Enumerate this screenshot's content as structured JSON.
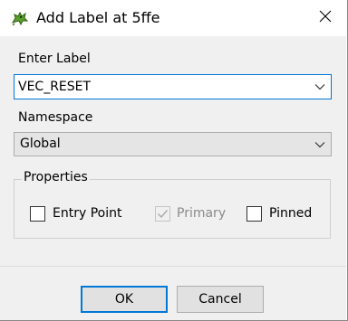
{
  "window": {
    "title": "Add Label at 5ffe",
    "icon": "green-dragon-icon",
    "close_icon": "close-icon"
  },
  "label_field": {
    "label": "Enter Label",
    "value": "VEC_RESET"
  },
  "namespace": {
    "label": "Namespace",
    "selected": "Global"
  },
  "properties": {
    "group_label": "Properties",
    "checkboxes": [
      {
        "label": "Entry Point",
        "checked": false,
        "enabled": true
      },
      {
        "label": "Primary",
        "checked": true,
        "enabled": false
      },
      {
        "label": "Pinned",
        "checked": false,
        "enabled": true
      }
    ]
  },
  "buttons": {
    "ok": "OK",
    "cancel": "Cancel"
  },
  "colors": {
    "focus_border": "#0078d7",
    "dialog_background": "#f0f0f0",
    "button_background": "#e1e1e1"
  }
}
